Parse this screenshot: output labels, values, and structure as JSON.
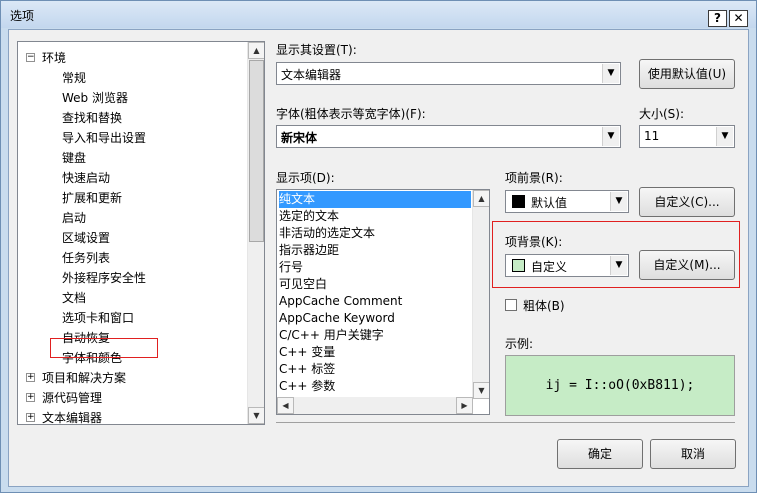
{
  "window": {
    "title": "选项",
    "help_label": "?",
    "close_label": "✕"
  },
  "tree": {
    "items": [
      {
        "label": "环境",
        "expander": "⊟"
      },
      {
        "label": "常规"
      },
      {
        "label": "Web 浏览器"
      },
      {
        "label": "查找和替换"
      },
      {
        "label": "导入和导出设置"
      },
      {
        "label": "键盘"
      },
      {
        "label": "快速启动"
      },
      {
        "label": "扩展和更新"
      },
      {
        "label": "启动"
      },
      {
        "label": "区域设置"
      },
      {
        "label": "任务列表"
      },
      {
        "label": "外接程序安全性"
      },
      {
        "label": "文档"
      },
      {
        "label": "选项卡和窗口"
      },
      {
        "label": "自动恢复"
      },
      {
        "label": "字体和颜色"
      },
      {
        "label": "项目和解决方案",
        "expander": "⊞"
      },
      {
        "label": "源代码管理",
        "expander": "⊞"
      },
      {
        "label": "文本编辑器",
        "expander": "⊞"
      }
    ]
  },
  "settings": {
    "show_settings_label": "显示其设置(T):",
    "show_settings_value": "文本编辑器",
    "use_defaults_label": "使用默认值(U)",
    "font_label": "字体(粗体表示等宽字体)(F):",
    "font_value": "新宋体",
    "size_label": "大小(S):",
    "size_value": "11",
    "display_items_label": "显示项(D):",
    "display_items": [
      "纯文本",
      "选定的文本",
      "非活动的选定文本",
      "指示器边距",
      "行号",
      "可见空白",
      "AppCache Comment",
      "AppCache Keyword",
      "C/C++ 用户关键字",
      "C++ 变量",
      "C++ 标签",
      "C++ 参数"
    ],
    "item_foreground_label": "项前景(R):",
    "item_foreground_value": "默认值",
    "item_foreground_color": "#000000",
    "custom_fg_label": "自定义(C)...",
    "item_background_label": "项背景(K):",
    "item_background_value": "自定义",
    "item_background_color": "#c6ecc6",
    "custom_bg_label": "自定义(M)...",
    "bold_label": "粗体(B)",
    "sample_label": "示例:",
    "sample_text": "ij = I::oO(0xB811);"
  },
  "footer": {
    "ok_label": "确定",
    "cancel_label": "取消"
  }
}
